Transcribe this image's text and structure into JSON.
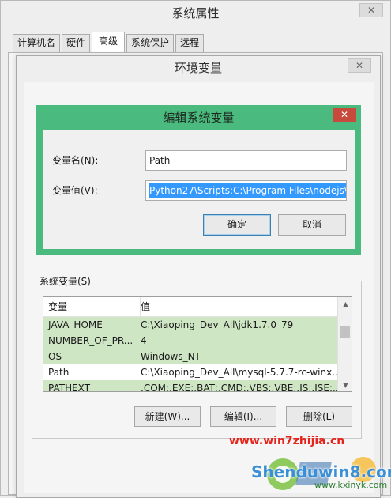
{
  "outer_window": {
    "title": "系统属性",
    "close_glyph": "✕",
    "tabs": [
      "计算机名",
      "硬件",
      "高级",
      "系统保护",
      "远程"
    ],
    "active_tab": "高级"
  },
  "env_window": {
    "title": "环境变量",
    "close_glyph": "✕",
    "system_vars_label": "系统变量(S)",
    "list": {
      "headers": [
        "变量",
        "值"
      ],
      "rows": [
        {
          "name": "JAVA_HOME",
          "value": "C:\\Xiaoping_Dev_All\\jdk1.7.0_79"
        },
        {
          "name": "NUMBER_OF_PR...",
          "value": "4"
        },
        {
          "name": "OS",
          "value": "Windows_NT"
        },
        {
          "name": "Path",
          "value": "C:\\Xiaoping_Dev_All\\mysql-5.7.7-rc-winx..."
        },
        {
          "name": "PATHEXT",
          "value": ".COM;.EXE;.BAT;.CMD;.VBS;.VBE;.JS;.JSE;..."
        }
      ]
    },
    "buttons": {
      "new": "新建(W)...",
      "edit": "编辑(I)...",
      "delete": "删除(L)"
    }
  },
  "edit_dialog": {
    "title": "编辑系统变量",
    "close_glyph": "✕",
    "name_label": "变量名(N):",
    "name_value": "Path",
    "value_label": "变量值(V):",
    "value_value": "Python27\\Scripts;C:\\Program Files\\nodejs\\",
    "ok": "确定",
    "cancel": "取消",
    "accent_color": "#4aba7e"
  },
  "watermark": {
    "url": "www.win7zhijia.cn",
    "site": "Shenduwin8.com",
    "site2": "www.kxinyk.com"
  }
}
